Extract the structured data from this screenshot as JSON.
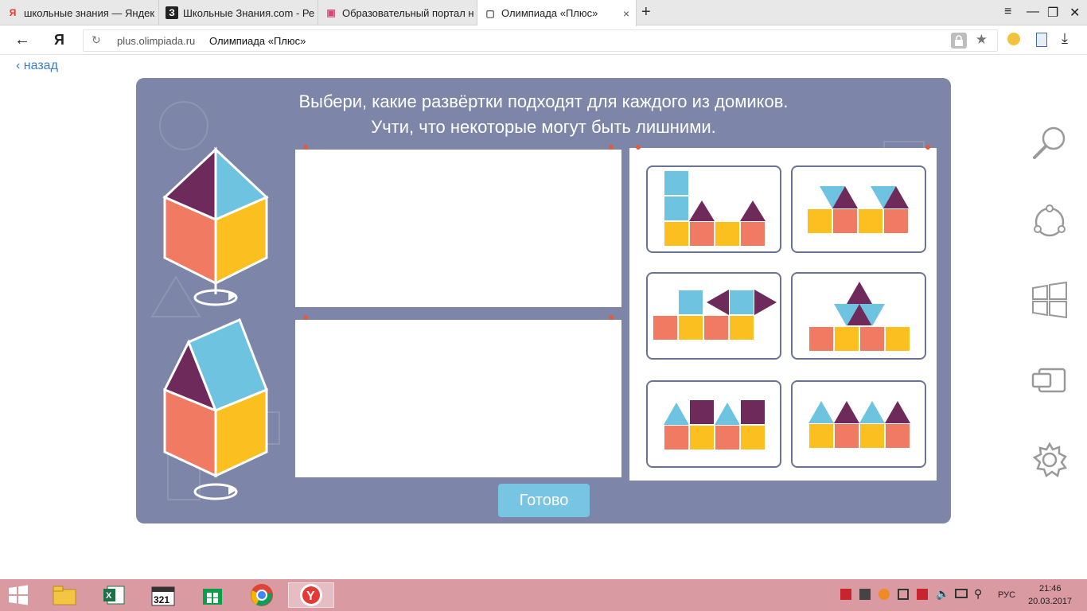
{
  "browser": {
    "tabs": [
      {
        "label": "школьные знания — Яндек",
        "favicon": "Я",
        "favicon_color": "#e53935"
      },
      {
        "label": "Школьные Знания.com - Ре",
        "favicon": "З",
        "favicon_color": "#222222"
      },
      {
        "label": "Образовательный портал н",
        "favicon": "▣",
        "favicon_color": "#d04a7a"
      },
      {
        "label": "Олимпиада «Плюс»",
        "favicon": "▢",
        "favicon_color": "#555555"
      }
    ],
    "active_tab_close": "×",
    "new_tab": "+",
    "window_controls": {
      "menu": "≡",
      "minimize": "—",
      "restore": "❐",
      "close": "✕"
    },
    "back_icon": "←",
    "logo": "Я",
    "reload_icon": "↻",
    "domain": "plus.olimpiada.ru",
    "page_title": "Олимпиада «Плюс»",
    "lock_icon": "🔒",
    "star_icon": "★",
    "download_icon": "⤓"
  },
  "page": {
    "back_link": "назад",
    "instruction_line1": "Выбери, какие развёртки подходят для каждого из домиков.",
    "instruction_line2": "Учти, что некоторые могут быть лишними.",
    "done_button": "Готово"
  },
  "colors": {
    "purple": "#6e2a5a",
    "blue": "#6ec3e0",
    "salmon": "#f07a62",
    "yellow": "#fbbf1f",
    "card_bg": "#7d86a8",
    "taskbar": "#d99aa2"
  },
  "taskbar": {
    "lang": "РУС",
    "time": "21:46",
    "date": "20.03.2017"
  }
}
